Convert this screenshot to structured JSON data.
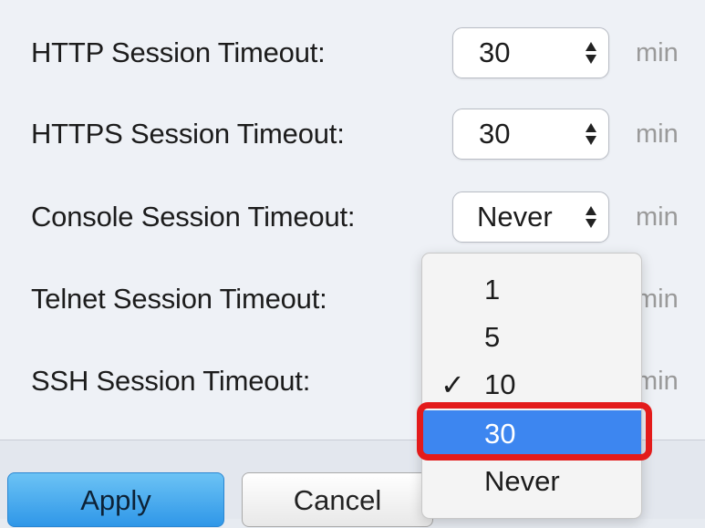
{
  "rows": [
    {
      "label": "HTTP Session Timeout:",
      "value": "30",
      "unit": "min"
    },
    {
      "label": "HTTPS Session Timeout:",
      "value": "30",
      "unit": "min"
    },
    {
      "label": "Console Session Timeout:",
      "value": "Never",
      "unit": "min"
    },
    {
      "label": "Telnet Session Timeout:",
      "unit": "min"
    },
    {
      "label": "SSH Session Timeout:",
      "unit": "min"
    }
  ],
  "dropdown": {
    "options": [
      "1",
      "5",
      "10",
      "30",
      "Never"
    ],
    "checked_option": "10",
    "highlighted_option": "30",
    "check_mark": "✓"
  },
  "buttons": {
    "apply": "Apply",
    "cancel": "Cancel"
  },
  "colors": {
    "highlight": "#3d86f0",
    "annotation": "#e31b1b",
    "apply": "#2f97e8"
  }
}
